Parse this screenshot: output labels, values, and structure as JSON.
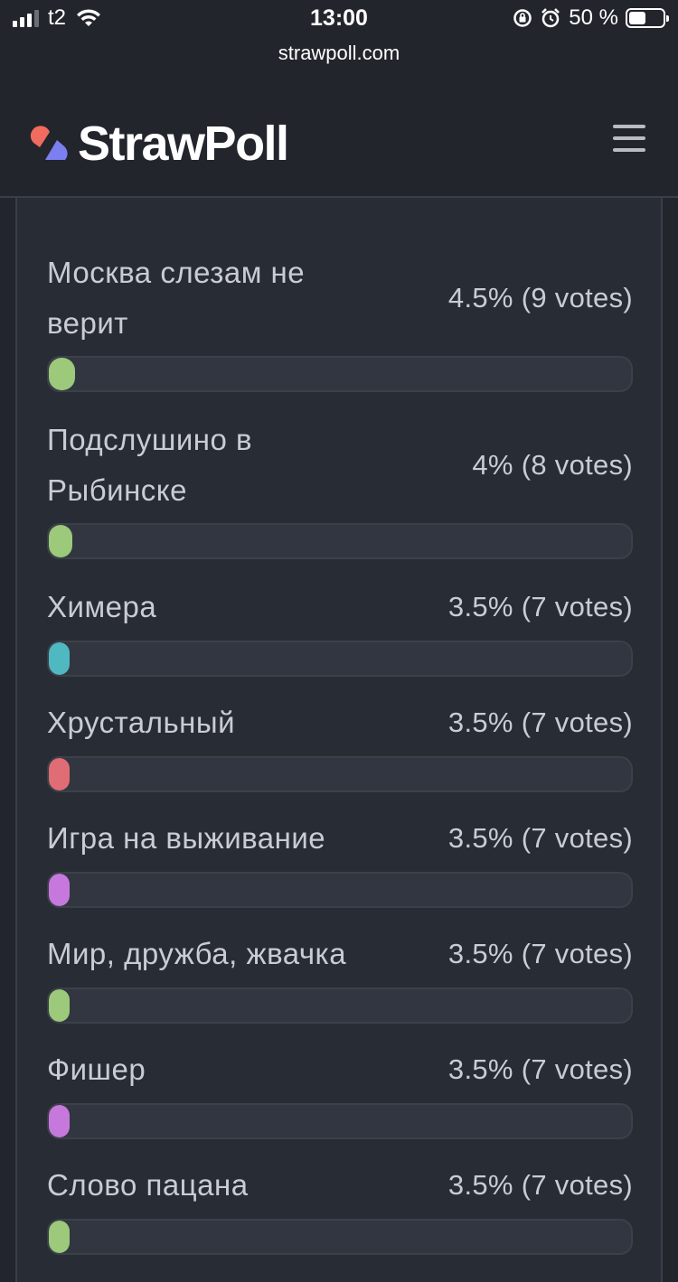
{
  "status_bar": {
    "carrier": "t2",
    "time": "13:00",
    "battery": "50 %",
    "battery_level": 0.5
  },
  "browser": {
    "url": "strawpoll.com"
  },
  "header": {
    "logo_text": "StrawPoll",
    "menu_icon": "hamburger-menu-icon"
  },
  "results": [
    {
      "label": "Москва слезам не верит",
      "stats": "4.5% (9 votes)",
      "percent": 4.5,
      "color": "#9cc97a"
    },
    {
      "label": "Подслушино в Рыбинске",
      "stats": "4% (8 votes)",
      "percent": 4,
      "color": "#9cc97a"
    },
    {
      "label": "Химера",
      "stats": "3.5% (7 votes)",
      "percent": 3.5,
      "color": "#4fb8c0"
    },
    {
      "label": "Хрустальный",
      "stats": "3.5% (7 votes)",
      "percent": 3.5,
      "color": "#e06c75"
    },
    {
      "label": "Игра на выживание",
      "stats": "3.5% (7 votes)",
      "percent": 3.5,
      "color": "#c678dd"
    },
    {
      "label": "Мир, дружба, жвачка",
      "stats": "3.5% (7 votes)",
      "percent": 3.5,
      "color": "#9cc97a"
    },
    {
      "label": "Фишер",
      "stats": "3.5% (7 votes)",
      "percent": 3.5,
      "color": "#c678dd"
    },
    {
      "label": "Слово пацана",
      "stats": "3.5% (7 votes)",
      "percent": 3.5,
      "color": "#9cc97a"
    }
  ]
}
